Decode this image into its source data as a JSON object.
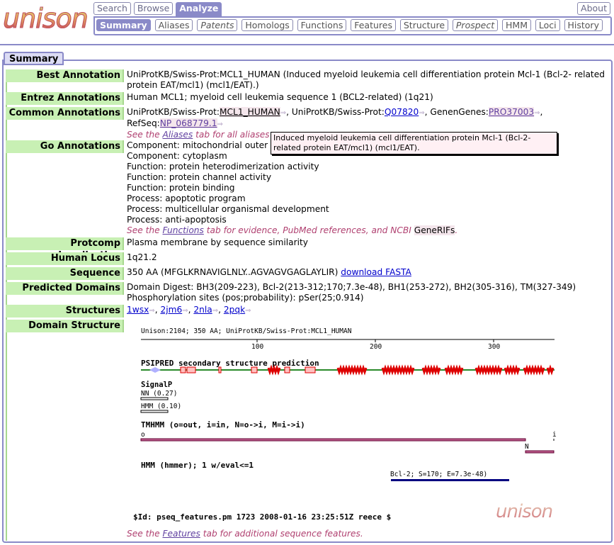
{
  "brand": {
    "logo_text": "unison"
  },
  "nav": {
    "top_tabs": [
      "Search",
      "Browse",
      "Analyze"
    ],
    "about": "About",
    "sub_tabs": [
      "Summary",
      "Aliases",
      "Patents",
      "Homologs",
      "Functions",
      "Features",
      "Structure",
      "Prospect",
      "HMM",
      "Loci",
      "History"
    ]
  },
  "section": {
    "title": "Summary"
  },
  "rows": {
    "best": {
      "label": "Best Annotation",
      "value": "UniProtKB/Swiss-Prot:MCL1_HUMAN (Induced myeloid leukemia cell differentiation protein Mcl-1 (Bcl-2- related protein EAT/mcl1) (mcl1/EAT).)"
    },
    "entrez": {
      "label": "Entrez Annotations",
      "value": "Human MCL1; myeloid cell leukemia sequence 1 (BCL2-related) (1q21)"
    },
    "common": {
      "label": "Common Annotations",
      "p1": "UniProtKB/Swiss-Prot:",
      "l1": "MCL1_HUMAN",
      "p2": ", UniProtKB/Swiss-Prot:",
      "l2": "Q07820",
      "p3": ", GenenGenes:",
      "l3": "PRO37003",
      "p4": ",",
      "p5": "RefSeq:",
      "l4": "NP_068779.1",
      "note_a": "See the ",
      "note_link": "Aliases",
      "note_b": " tab for all aliases"
    },
    "go": {
      "label": "Go Annotations",
      "lines": [
        "Component: mitochondrial outer",
        "Component: cytoplasm",
        "Function: protein heterodimerization activity",
        "Function: protein channel activity",
        "Function: protein binding",
        "Process: apoptotic program",
        "Process: multicellular organismal development",
        "Process: anti-apoptosis"
      ],
      "note_a": "See the ",
      "note_link": "Functions",
      "note_b": " tab for evidence, PubMed references, and NCBI ",
      "note_c": "GeneRIFs",
      "note_d": "."
    },
    "protcomp": {
      "label": "Protcomp Localization",
      "value": "Plasma membrane by sequence similarity"
    },
    "locus": {
      "label": "Human Locus",
      "value": "1q21.2"
    },
    "sequence": {
      "label": "Sequence",
      "value": "350 AA (MFGLKRNAVIGLNLY..AGVAGVGAGLAYLIR)",
      "link": "download FASTA"
    },
    "domains": {
      "label": "Predicted Domains",
      "line1": "Domain Digest: BH3(209-223), Bcl-2(213-312;170;7.3e-48), BH1(253-272), BH2(305-316), TM(327-349)",
      "line2": "Phosphorylation sites (pos;probability): pSer(25;0.914)"
    },
    "structures": {
      "label": "Structures",
      "items": [
        "1wsx",
        "2jm6",
        "2nla",
        "2pqk"
      ]
    },
    "domain_structure": {
      "label": "Domain Structure"
    }
  },
  "tooltip": "Induced myeloid leukemia cell differentiation protein Mcl-1 (Bcl-2- related protein EAT/mcl1) (mcl1/EAT).",
  "figure": {
    "header": "Unison:2104; 350 AA; UniProtKB/Swiss-Prot:MCL1_HUMAN",
    "ticks": [
      "100",
      "200",
      "300"
    ],
    "psipred": "PSIPRED secondary structure prediction",
    "signalp": "SignalP",
    "nn": "NN  (0.27)",
    "hmm_sp": "HMM (0.10)",
    "tmhmm": "TMHMM (o=out, i=in, N=o->i, M=i->i)",
    "tm_o": "o",
    "tm_i": "i",
    "tm_n": "N",
    "hmmer": "HMM (hmmer); 1 w/eval<=1",
    "bcl2": "Bcl-2; S=170; E=7.3e-48)",
    "id_line": "$Id: pseq_features.pm 1723 2008-01-16 23:25:51Z reece $",
    "watermark": "unison"
  },
  "footer_note": {
    "a": "See the ",
    "link": "Features",
    "b": " tab for additional sequence features."
  },
  "colors": {
    "accent": "#8a8ac8",
    "label_bg": "#c8f0b4",
    "helix": "#dd0000",
    "strand": "#ff9090",
    "tm": "#800040",
    "domain": "#000080"
  }
}
